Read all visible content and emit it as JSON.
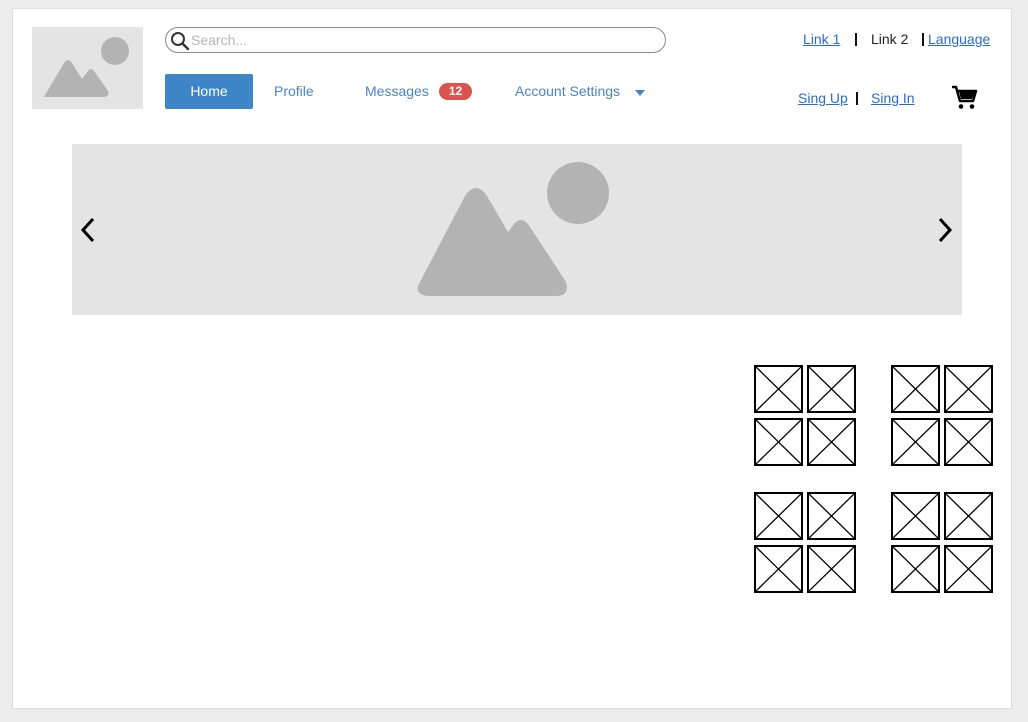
{
  "search": {
    "placeholder": "Search..."
  },
  "nav": {
    "home": "Home",
    "profile": "Profile",
    "messages": "Messages",
    "messages_count": "12",
    "account_settings": "Account Settings"
  },
  "top_links": {
    "link1": "Link 1",
    "link2": "Link 2",
    "language": "Language",
    "sign_up": "Sing Up",
    "sign_in": "Sing In"
  },
  "colors": {
    "accent": "#3f86c8",
    "badge": "#d9534f",
    "link": "#2a6bd0",
    "placeholder_fill": "#e4e4e4",
    "placeholder_shape": "#b3b3b3"
  },
  "icons": {
    "search": "search-icon",
    "cart": "cart-icon",
    "prev": "chevron-left-icon",
    "next": "chevron-right-icon",
    "image": "image-placeholder-icon",
    "thumb": "broken-image-icon"
  }
}
